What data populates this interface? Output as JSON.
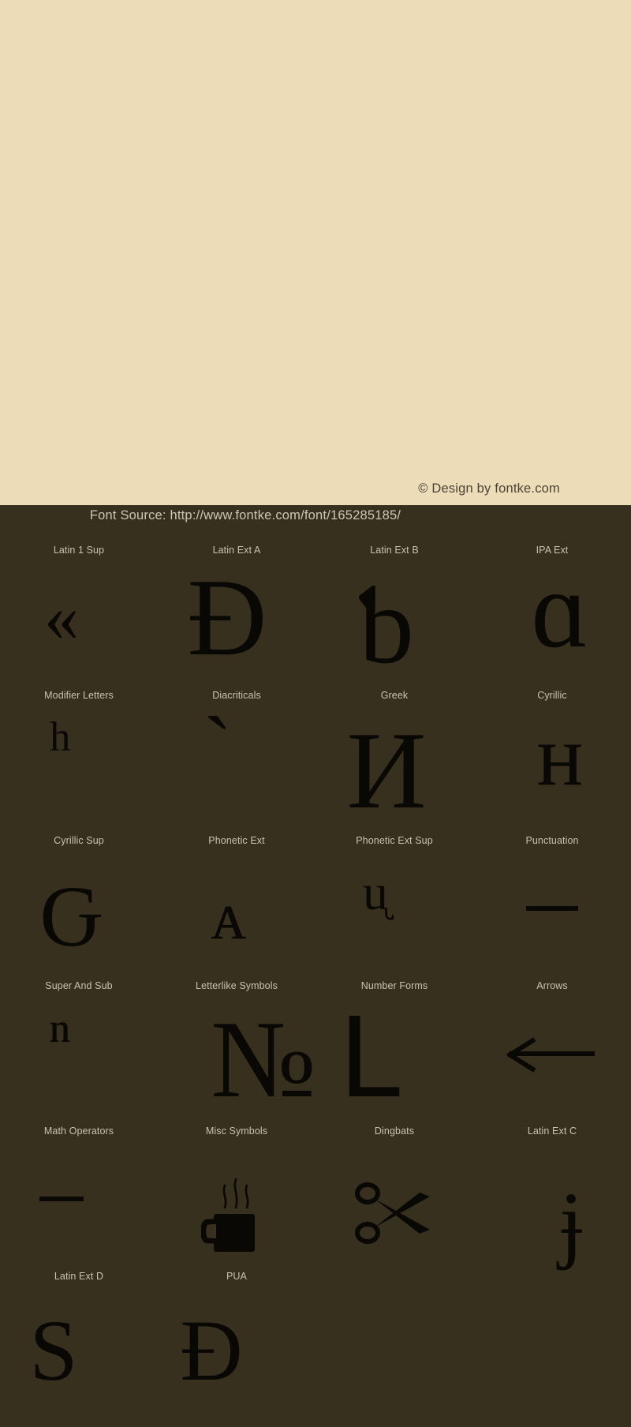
{
  "page": {
    "background_cream": "#ecdcb8",
    "background_dark": "#38301e",
    "glyph_color": "#0a0805",
    "label_color": "#cbc2ad"
  },
  "preview": {
    "copyright": "© Design by fontke.com"
  },
  "source": {
    "text": "Font Source: http://www.fontke.com/font/165285185/"
  },
  "blocks": [
    {
      "label": "Latin 1 Sup",
      "glyph": "«",
      "icon": "guillemet-left-glyph"
    },
    {
      "label": "Latin Ext A",
      "glyph": "Đ",
      "icon": "d-with-stroke-glyph"
    },
    {
      "label": "Latin Ext B",
      "glyph": "ƅ",
      "icon": "b-tone-six-glyph"
    },
    {
      "label": "IPA Ext",
      "glyph": "ɑ",
      "icon": "latin-alpha-glyph"
    },
    {
      "label": "Modifier Letters",
      "glyph": "ʰ",
      "icon": "modifier-letter-h-glyph"
    },
    {
      "label": "Diacriticals",
      "glyph": "ˋ",
      "icon": "combining-grave-accent-glyph"
    },
    {
      "label": "Greek",
      "glyph": "И",
      "icon": "greek-sample-glyph"
    },
    {
      "label": "Cyrillic",
      "glyph": "н",
      "icon": "cyrillic-en-glyph"
    },
    {
      "label": "Cyrillic Sup",
      "glyph": "Ԍ",
      "icon": "cyrillic-komi-sje-glyph"
    },
    {
      "label": "Phonetic Ext",
      "glyph": "ᴀ",
      "icon": "small-capital-a-glyph"
    },
    {
      "label": "Phonetic Ext Sup",
      "glyph": "ᶙ",
      "icon": "modifier-u-retroflex-glyph"
    },
    {
      "label": "Punctuation",
      "glyph": "—",
      "icon": "em-dash-glyph"
    },
    {
      "label": "Super And Sub",
      "glyph": "ⁿ",
      "icon": "superscript-n-glyph"
    },
    {
      "label": "Letterlike Symbols",
      "glyph": "№",
      "icon": "numero-sign-glyph"
    },
    {
      "label": "Number Forms",
      "glyph": "Ⅼ",
      "icon": "roman-numeral-fifty-glyph"
    },
    {
      "label": "Arrows",
      "glyph": "←",
      "icon": "leftwards-arrow-glyph"
    },
    {
      "label": "Math Operators",
      "glyph": "−",
      "icon": "minus-sign-glyph"
    },
    {
      "label": "Misc Symbols",
      "glyph": "☕",
      "icon": "hot-beverage-glyph"
    },
    {
      "label": "Dingbats",
      "glyph": "✂",
      "icon": "scissors-glyph"
    },
    {
      "label": "Latin Ext C",
      "glyph": "ɉ",
      "icon": "j-with-stroke-glyph"
    },
    {
      "label": "Latin Ext D",
      "glyph": "S",
      "icon": "latin-capital-s-glyph"
    },
    {
      "label": "PUA",
      "glyph": "Đ",
      "icon": "pua-d-with-stroke-glyph"
    }
  ]
}
